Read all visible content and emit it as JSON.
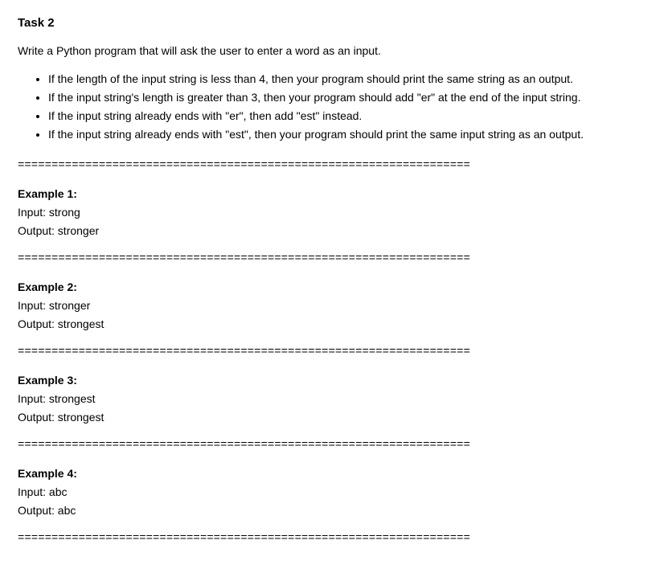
{
  "task": {
    "title": "Task 2",
    "intro": "Write a Python program that will ask the user to enter a word as an input.",
    "bullets": [
      "If the length of the input string is less than 4, then your program should print the same string as an output.",
      "If the input string's length is greater than 3, then your program should add \"er\" at the end of the input string.",
      "If the input string already ends with \"er\", then add \"est\" instead.",
      "If the input string already ends with \"est\", then your program should print the same input string as an output."
    ],
    "divider": "===================================================================",
    "examples": [
      {
        "label": "Example 1:",
        "input": "Input: strong",
        "output": "Output: stronger"
      },
      {
        "label": "Example 2:",
        "input": "Input: stronger",
        "output": "Output: strongest"
      },
      {
        "label": "Example 3:",
        "input": "Input: strongest",
        "output": "Output: strongest"
      },
      {
        "label": "Example 4:",
        "input": "Input: abc",
        "output": "Output: abc"
      }
    ]
  }
}
